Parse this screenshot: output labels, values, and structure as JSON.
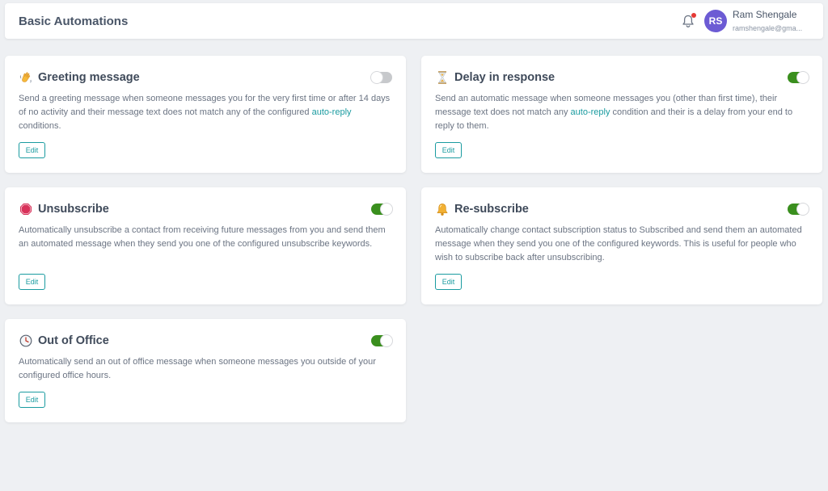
{
  "header": {
    "title": "Basic Automations",
    "user": {
      "initials": "RS",
      "name": "Ram Shengale",
      "email": "ramshengale@gma..."
    }
  },
  "colors": {
    "accent": "#1a9ba0",
    "toggle_on": "#3a8f1e",
    "avatar": "#6c5bd4",
    "notification": "#e53935"
  },
  "cards": [
    {
      "icon": "waving-hand-icon",
      "title": "Greeting message",
      "enabled": false,
      "desc_before": "Send a greeting message when someone messages you for the very first time or after 14 days of no activity and their message text does not match any of the configured ",
      "link": "auto-reply",
      "desc_after": " conditions.",
      "edit_label": "Edit"
    },
    {
      "icon": "hourglass-icon",
      "title": "Delay in response",
      "enabled": true,
      "desc_before": "Send an automatic message when someone messages you (other than first time), their message text does not match any ",
      "link": "auto-reply",
      "desc_after": " condition and their is a delay from your end to reply to them.",
      "edit_label": "Edit"
    },
    {
      "icon": "stop-sign-icon",
      "title": "Unsubscribe",
      "enabled": true,
      "desc": "Automatically unsubscribe a contact from receiving future messages from you and send them an automated message when they send you one of the configured unsubscribe keywords.",
      "edit_label": "Edit"
    },
    {
      "icon": "bell-icon",
      "title": "Re-subscribe",
      "enabled": true,
      "desc": "Automatically change contact subscription status to Subscribed and send them an automated message when they send you one of the configured keywords. This is useful for people who wish to subscribe back after unsubscribing.",
      "edit_label": "Edit"
    },
    {
      "icon": "clock-icon",
      "title": "Out of Office",
      "enabled": true,
      "desc": "Automatically send an out of office message when someone messages you outside of your configured office hours.",
      "edit_label": "Edit"
    }
  ]
}
